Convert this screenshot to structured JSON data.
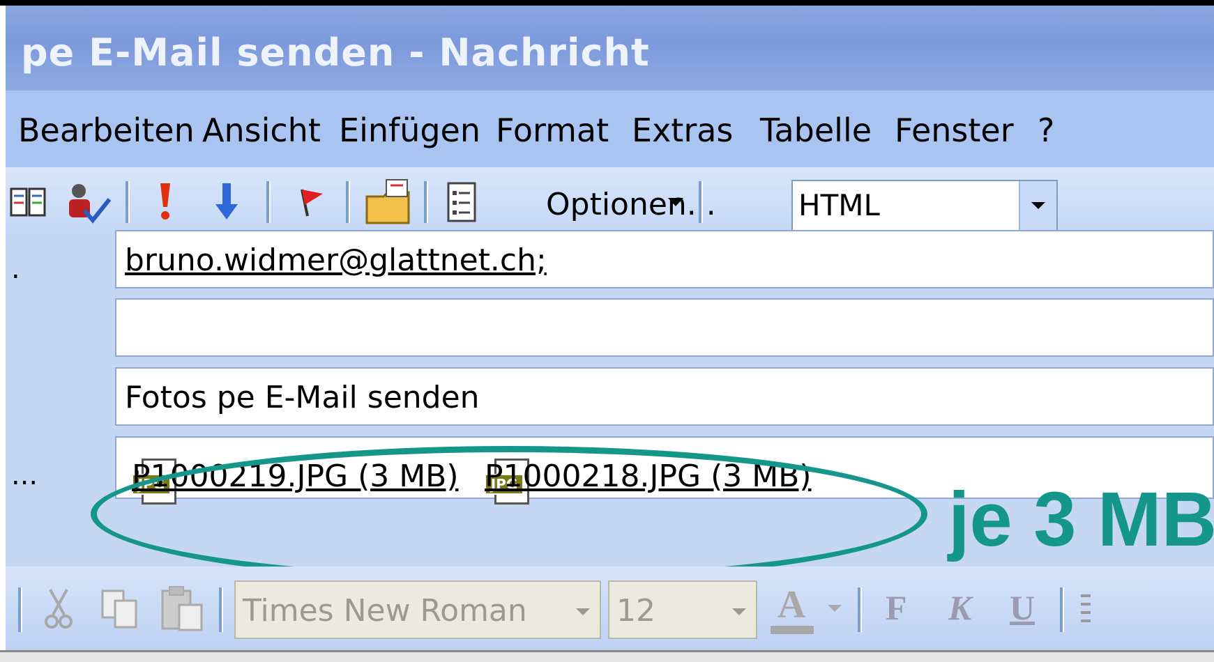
{
  "window": {
    "title": "pe E-Mail senden - Nachricht"
  },
  "menu": [
    "Bearbeiten",
    "Ansicht",
    "Einfügen",
    "Format",
    "Extras",
    "Tabelle",
    "Fenster",
    "?"
  ],
  "toolbar": {
    "options_label": "Optionen...",
    "format_value": "HTML"
  },
  "message": {
    "to": "bruno.widmer@glattnet.ch;",
    "cc": "",
    "subject": "Fotos pe E-Mail senden",
    "to_label": ".",
    "attach_label": "...",
    "attachments": [
      {
        "icon_text": "JPG",
        "name": "P1000219.JPG (3 MB)",
        "sep": ";"
      },
      {
        "icon_text": "JPG",
        "name": "P1000218.JPG (3 MB)",
        "sep": ""
      }
    ]
  },
  "annotation": {
    "text": "je 3 MB",
    "color": "#14968b"
  },
  "format_toolbar": {
    "font": "Times New Roman",
    "size": "12",
    "font_color_letter": "A",
    "bold": "F",
    "italic": "K",
    "underline": "U"
  }
}
